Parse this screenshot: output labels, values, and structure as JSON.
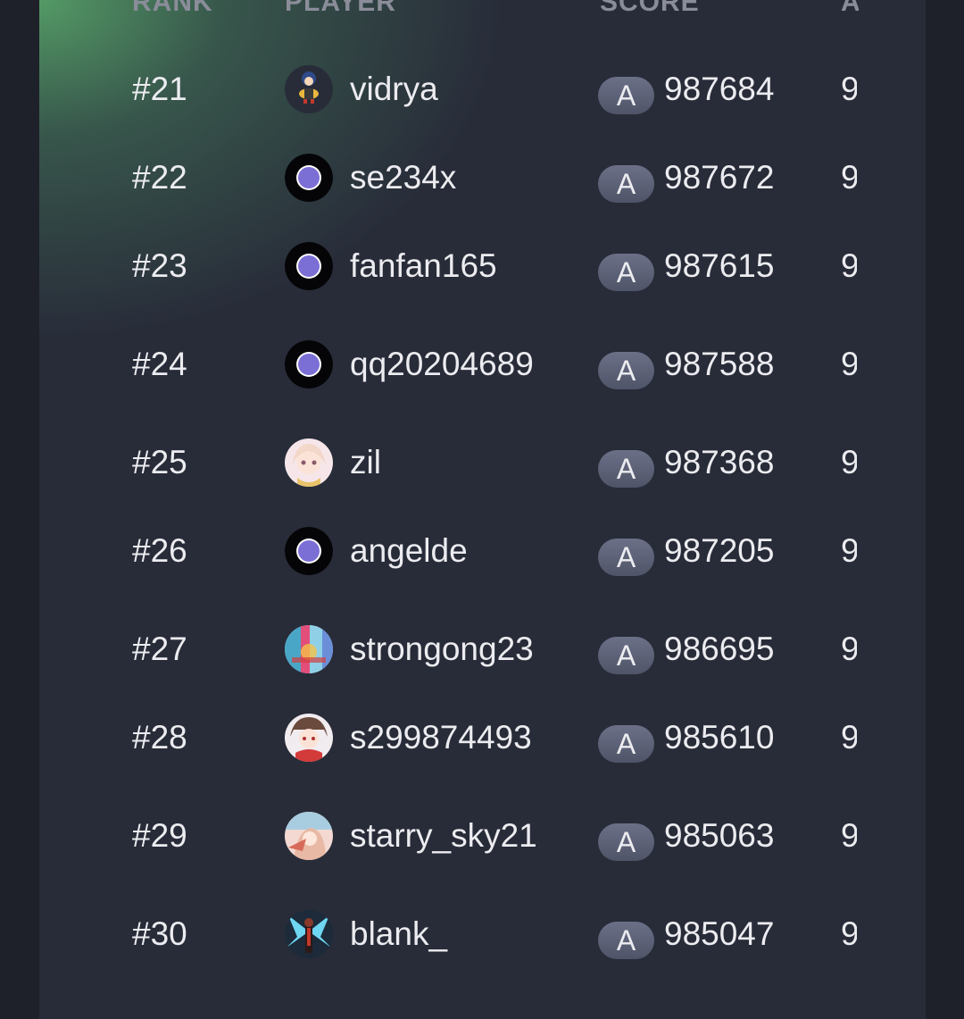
{
  "header": {
    "rank": "RANK",
    "player": "PLAYER",
    "score": "SCORE",
    "accuracy": "A"
  },
  "rows": [
    {
      "rank": "#21",
      "name": "vidrya",
      "grade": "A",
      "score": "987684",
      "acc": "9",
      "avatar": "chibi-character"
    },
    {
      "rank": "#22",
      "name": "se234x",
      "grade": "A",
      "score": "987672",
      "acc": "9",
      "avatar": "default-orb"
    },
    {
      "rank": "#23",
      "name": "fanfan165",
      "grade": "A",
      "score": "987615",
      "acc": "9",
      "avatar": "default-orb"
    },
    {
      "rank": "#24",
      "name": "qq20204689",
      "grade": "A",
      "score": "987588",
      "acc": "9",
      "avatar": "default-orb"
    },
    {
      "rank": "#25",
      "name": "zil",
      "grade": "A",
      "score": "987368",
      "acc": "9",
      "avatar": "anime-girl"
    },
    {
      "rank": "#26",
      "name": "angelde",
      "grade": "A",
      "score": "987205",
      "acc": "9",
      "avatar": "default-orb"
    },
    {
      "rank": "#27",
      "name": "strongong23",
      "grade": "A",
      "score": "986695",
      "acc": "9",
      "avatar": "colorful-abstract"
    },
    {
      "rank": "#28",
      "name": "s299874493",
      "grade": "A",
      "score": "985610",
      "acc": "9",
      "avatar": "anime-red"
    },
    {
      "rank": "#29",
      "name": "starry_sky21",
      "grade": "A",
      "score": "985063",
      "acc": "9",
      "avatar": "anime-pastel"
    },
    {
      "rank": "#30",
      "name": "blank_",
      "grade": "A",
      "score": "985047",
      "acc": "9",
      "avatar": "winged-figure"
    }
  ],
  "colors": {
    "page_bg": "#1e2129",
    "panel_bg": "#282c39",
    "glow": "#56a068",
    "grade_badge": "#5d6277",
    "text": "#ececf0"
  }
}
